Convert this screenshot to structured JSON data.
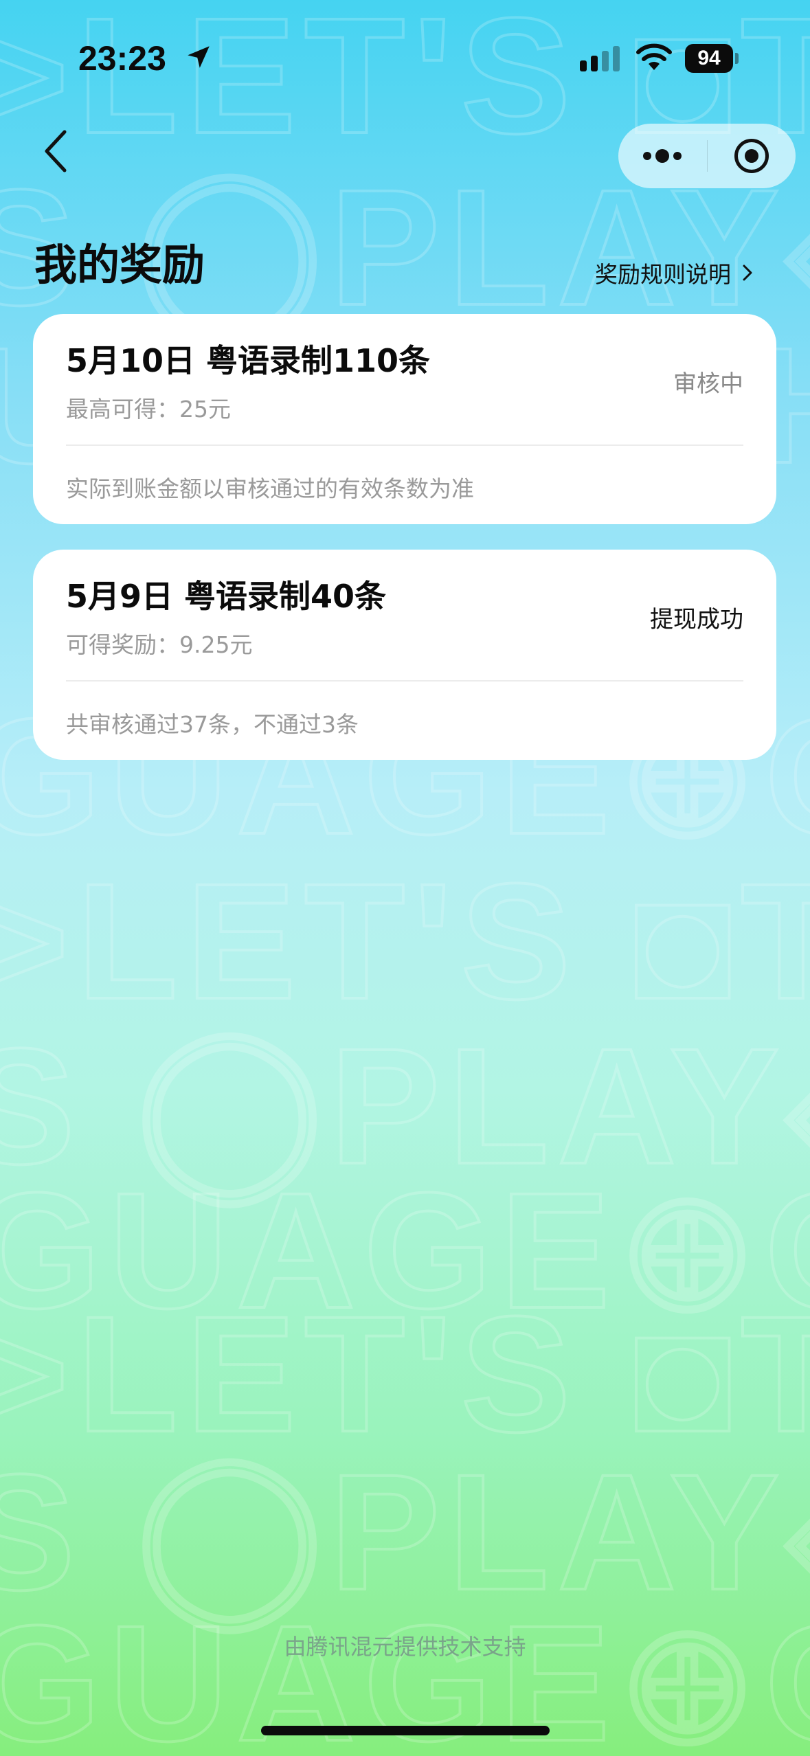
{
  "status_bar": {
    "time": "23:23",
    "battery": "94",
    "location_icon": "location-arrow-icon",
    "signal_icon": "cellular-signal-icon",
    "wifi_icon": "wifi-icon"
  },
  "nav": {
    "back_icon": "chevron-left-icon",
    "more_icon": "more-dots-icon",
    "close_icon": "target-circle-icon"
  },
  "header": {
    "title": "我的奖励",
    "rules_link": "奖励规则说明"
  },
  "rewards": [
    {
      "title": "5月10日  粤语录制110条",
      "subtitle": "最高可得：25元",
      "status": "审核中",
      "status_color": "#8a8a8a",
      "note": "实际到账金额以审核通过的有效条数为准"
    },
    {
      "title": "5月9日  粤语录制40条",
      "subtitle": "可得奖励：9.25元",
      "status": "提现成功",
      "status_color": "#111111",
      "note": "共审核通过37条，不通过3条"
    }
  ],
  "footer": {
    "powered_by": "由腾讯混元提供技术支持"
  },
  "theme": {
    "gradient_top": "#45d3f1",
    "gradient_bottom": "#86ee7d"
  }
}
